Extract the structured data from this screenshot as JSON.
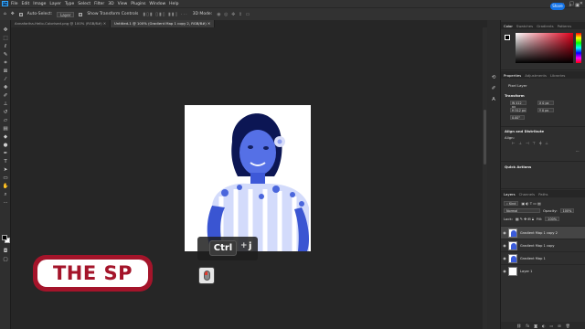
{
  "menubar": {
    "logo": "Ps",
    "items": [
      "File",
      "Edit",
      "Image",
      "Layer",
      "Type",
      "Select",
      "Filter",
      "3D",
      "View",
      "Plugins",
      "Window",
      "Help"
    ],
    "window_controls": [
      "—",
      "□",
      "✕"
    ]
  },
  "optbar": {
    "auto_select_label": "Auto-Select:",
    "auto_select_target": "Layer",
    "transform_label": "Show Transform Controls",
    "mode_3d": "3D Mode:",
    "share_label": "Share"
  },
  "tabs": [
    {
      "label": "Annafariha-Hello-Colorised.png @ 100% (RGB/8#)",
      "active": false
    },
    {
      "label": "Untitled-1 @ 100% (Gradient Map 1 copy 2, RGB/8#)",
      "active": true
    }
  ],
  "overlay": {
    "key_ctrl": "Ctrl",
    "key_plus": "+",
    "key_j": "j",
    "banner_text": "THE SP"
  },
  "colors": {
    "banner_red": "#a4142a",
    "accent_blue": "#1473e6",
    "photo_tint": "#3a5bd9"
  },
  "color_panel": {
    "tabs": [
      "Color",
      "Swatches",
      "Gradients",
      "Patterns"
    ]
  },
  "properties_panel": {
    "tabs": [
      "Properties",
      "Adjustments",
      "Libraries"
    ],
    "layer_type": "Pixel Layer",
    "transform_title": "Transform",
    "w": "W 412 px",
    "h": "H 512 px",
    "x": "X 0 px",
    "y": "Y 0 px",
    "angle": "0.00°",
    "align_title": "Align and Distribute",
    "align_label": "Align:",
    "quick_actions_title": "Quick Actions"
  },
  "layers_panel": {
    "tabs": [
      "Layers",
      "Channels",
      "Paths"
    ],
    "kind": "Kind",
    "blend_mode": "Normal",
    "opacity_label": "Opacity:",
    "opacity_value": "100%",
    "lock_label": "Lock:",
    "fill_label": "Fill:",
    "fill_value": "100%",
    "layers": [
      {
        "name": "Gradient Map 1 copy 2",
        "selected": true
      },
      {
        "name": "Gradient Map 1 copy",
        "selected": false
      },
      {
        "name": "Gradient Map 1",
        "selected": false
      },
      {
        "name": "Layer 1",
        "selected": false
      }
    ],
    "bottom_icons": [
      "link-icon",
      "fx-icon",
      "mask-icon",
      "adjustment-icon",
      "folder-icon",
      "new-layer-icon",
      "trash-icon"
    ]
  }
}
